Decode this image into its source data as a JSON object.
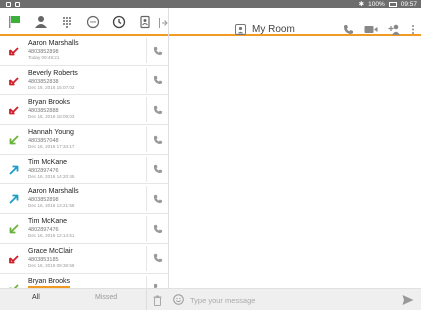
{
  "status_bar": {
    "battery": "100%",
    "time": "09:57"
  },
  "header": {
    "room_title": "My Room"
  },
  "calls": [
    {
      "name": "Aaron Marshalls",
      "number": "4803852898",
      "time": "Today 09:48:21",
      "direction": "missed"
    },
    {
      "name": "Beverly Roberts",
      "number": "4803852838",
      "time": "Dec 16, 2016 15:07:02",
      "direction": "missed"
    },
    {
      "name": "Bryan Brooks",
      "number": "4803852888",
      "time": "Dec 16, 2016 18:09:03",
      "direction": "missed"
    },
    {
      "name": "Hannah Young",
      "number": "4803857048",
      "time": "Dec 16, 2016 17:34:17",
      "direction": "incoming"
    },
    {
      "name": "Tim McKane",
      "number": "4802897476",
      "time": "Dec 16, 2016 14:20:45",
      "direction": "outgoing"
    },
    {
      "name": "Aaron Marshalls",
      "number": "4803852898",
      "time": "Dec 16, 2016 13:21:58",
      "direction": "outgoing"
    },
    {
      "name": "Tim McKane",
      "number": "4802897476",
      "time": "Dec 16, 2016 12:14:51",
      "direction": "incoming"
    },
    {
      "name": "Grace McClair",
      "number": "4803853185",
      "time": "Dec 16, 2016 09:36:58",
      "direction": "missed"
    },
    {
      "name": "Bryan Brooks",
      "number": "",
      "time": "",
      "direction": "incoming"
    }
  ],
  "bottom": {
    "tab_all": "All",
    "tab_missed": "Missed",
    "message_placeholder": "Type your message"
  },
  "colors": {
    "accent": "#f39a22",
    "missed": "#d0202a",
    "incoming": "#6cb33e",
    "outgoing": "#1b9fc6"
  },
  "icons": [
    "flag-icon",
    "contact-icon",
    "dialpad-icon",
    "chat-icon",
    "history-icon",
    "contacts-book-icon",
    "collapse-icon",
    "room-icon",
    "phone-icon",
    "video-icon",
    "add-user-icon",
    "more-icon",
    "trash-icon",
    "smiley-icon",
    "send-icon"
  ]
}
